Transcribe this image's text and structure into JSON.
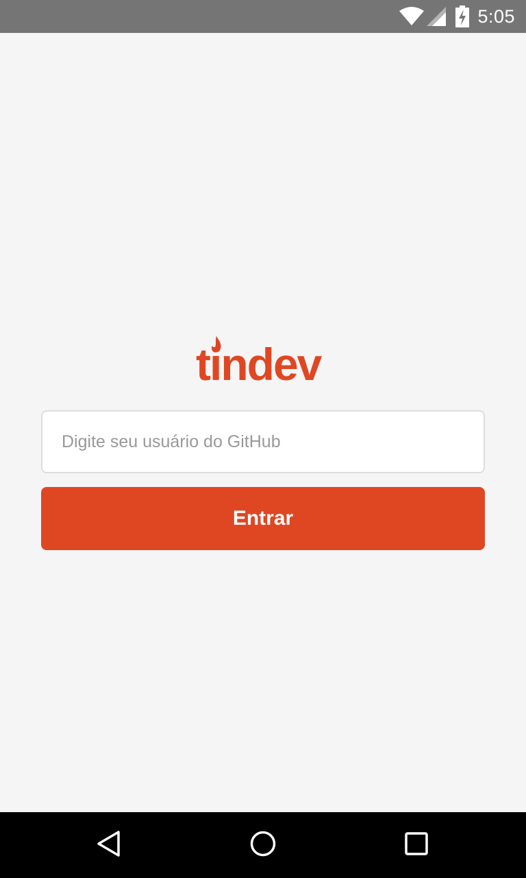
{
  "status_bar": {
    "time": "5:05",
    "icons": [
      "wifi-icon",
      "signal-icon",
      "battery-charging-icon"
    ],
    "background": "#757575"
  },
  "logo": {
    "text": "tindev",
    "color": "#df4723"
  },
  "login": {
    "username_placeholder": "Digite seu usuário do GitHub",
    "username_value": "",
    "submit_label": "Entrar"
  },
  "nav_bar": {
    "icons": [
      "back-icon",
      "home-icon",
      "recents-icon"
    ]
  },
  "colors": {
    "accent": "#df4723",
    "background": "#f5f5f5",
    "input_border": "#dddddd",
    "placeholder": "#999999"
  }
}
